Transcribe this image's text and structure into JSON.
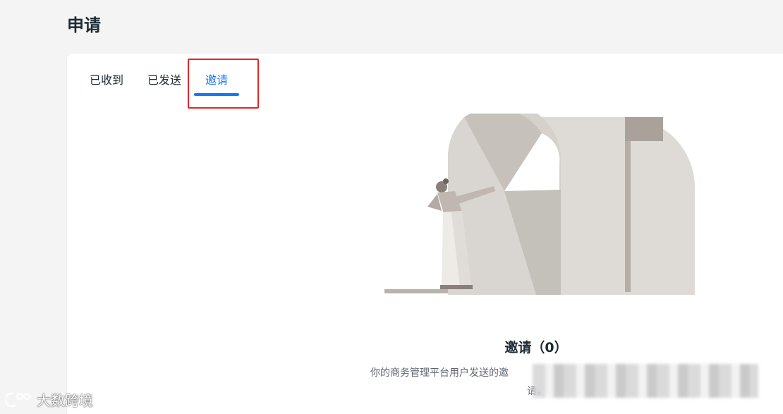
{
  "page": {
    "title": "申请"
  },
  "tabs": [
    {
      "label": "已收到",
      "active": false
    },
    {
      "label": "已发送",
      "active": false
    },
    {
      "label": "邀请",
      "active": true
    }
  ],
  "empty_state": {
    "title": "邀请（0）",
    "description_line1": "你的商务管理平台用户发送的邀",
    "description_line2": "请。"
  },
  "watermark": {
    "text": "大数跨境"
  },
  "colors": {
    "accent": "#1877f2",
    "highlight": "#e32626",
    "background": "#f4f4f4"
  }
}
